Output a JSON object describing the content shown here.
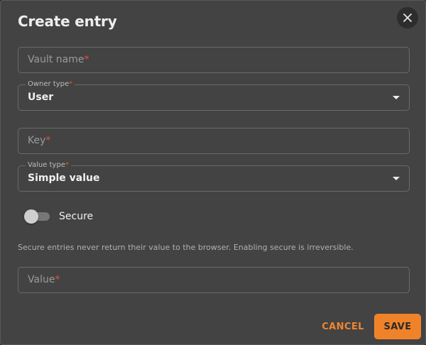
{
  "dialog": {
    "title": "Create entry",
    "close_icon": "close-icon"
  },
  "fields": {
    "vault_name": {
      "placeholder": "Vault name",
      "required_mark": "*"
    },
    "owner_type": {
      "label": "Owner type",
      "required_mark": "*",
      "value": "User"
    },
    "key": {
      "placeholder": "Key",
      "required_mark": "*"
    },
    "value_type": {
      "label": "Value type",
      "required_mark": "*",
      "value": "Simple value"
    },
    "value": {
      "placeholder": "Value",
      "required_mark": "*"
    }
  },
  "secure": {
    "label": "Secure",
    "enabled": false,
    "helper": "Secure entries never return their value to the browser. Enabling secure is irreversible."
  },
  "actions": {
    "cancel_label": "CANCEL",
    "save_label": "SAVE"
  },
  "colors": {
    "accent": "#f08329",
    "required": "#e0533d",
    "surface": "#434343"
  }
}
